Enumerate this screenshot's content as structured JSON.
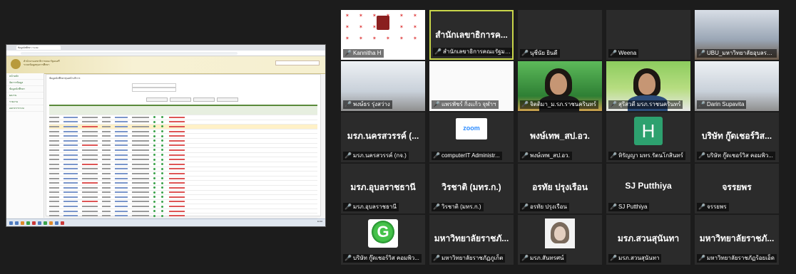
{
  "shared_screen": {
    "browser_tab": "ข้อมูลนักศึกษา / ระบบ",
    "banner_title": "สำนักงานเลขาธิการคณะรัฐมนตรี",
    "banner_subtitle": "ระบบข้อมูลทุนการศึกษา",
    "side_items": [
      "หน้าหลัก",
      "จัดการข้อมูล",
      "ข้อมูลนักศึกษา",
      "ผลงาน",
      "รายงาน",
      "ออกจากระบบ"
    ],
    "crumb": "ข้อมูลนักศึกษาทุนหน้าบริการ",
    "clock": "11:02"
  },
  "participants": [
    {
      "id": "p1",
      "video": "pattern",
      "name": "Kannitha H",
      "big": ""
    },
    {
      "id": "p2",
      "video": "none",
      "name": "สำนักเลขาธิการคณะรัฐมนตรี",
      "big": "สำนักเลขาธิการค...",
      "active": true
    },
    {
      "id": "p3",
      "video": "none",
      "name": "นุชี่นัย ยินดี",
      "big": ""
    },
    {
      "id": "p4",
      "video": "none",
      "name": "Weena",
      "big": ""
    },
    {
      "id": "p5",
      "video": "room",
      "name": "UBU_มหาวิทยาลัยอุบลรา...",
      "big": ""
    },
    {
      "id": "p6",
      "video": "office",
      "name": "พงษ์ธร รุ่งสว่าง",
      "big": ""
    },
    {
      "id": "p7",
      "video": "white",
      "name": "แพรพัชร์ กิ่งแก้ว จุฬาฯ",
      "big": ""
    },
    {
      "id": "p8",
      "video": "person-green",
      "name": "จิตติมา_ม.รภ.ราชนครินทร์",
      "big": ""
    },
    {
      "id": "p9",
      "video": "person-banner",
      "name": "สุรีสวดี มรภ.ราชนครินทร์",
      "big": ""
    },
    {
      "id": "p10",
      "video": "office2",
      "name": "Darin Supavita",
      "big": ""
    },
    {
      "id": "p11",
      "video": "none",
      "name": "มรภ.นครสวรรค์ (กจ.)",
      "big": "มรภ.นครสวรรค์ (..."
    },
    {
      "id": "p12",
      "video": "zoom",
      "name": "computerIT Administr...",
      "big": ""
    },
    {
      "id": "p13",
      "video": "none",
      "name": "พงษ์เทพ_สป.อว.",
      "big": "พงษ์เทพ_สป.อว."
    },
    {
      "id": "p14",
      "video": "h-avatar",
      "name": "หิรัญญา มทร.รัตนโกสินทร์",
      "big": ""
    },
    {
      "id": "p15",
      "video": "none",
      "name": "บริษัท กู๊ดเชอร์วิส คอมพิว...",
      "big": "บริษัท กู๊ดเชอร์วิส..."
    },
    {
      "id": "p16",
      "video": "none",
      "name": "มรภ.อุบลราชธานี",
      "big": "มรภ.อุบลราชธานี"
    },
    {
      "id": "p17",
      "video": "none",
      "name": "วิรชาติ (มทร.ก.)",
      "big": "วิรชาติ (มทร.ก.)"
    },
    {
      "id": "p18",
      "video": "none",
      "name": "อรทัย ปรุงเรือน",
      "big": "อรทัย ปรุงเรือน"
    },
    {
      "id": "p19",
      "video": "none",
      "name": "SJ Putthiya",
      "big": "SJ Putthiya"
    },
    {
      "id": "p20",
      "video": "none",
      "name": "จรรยพร",
      "big": "จรรยพร"
    },
    {
      "id": "p21",
      "video": "g-avatar",
      "name": "บริษัท กู๊ดเชอร์วิส คอมพิว...",
      "big": ""
    },
    {
      "id": "p22",
      "video": "none",
      "name": "มหาวิทยาลัยราชภัฏภูเก็ต",
      "big": "มหาวิทยาลัยราชภั..."
    },
    {
      "id": "p23",
      "video": "photo",
      "name": "มรภ.สันทรศน์",
      "big": ""
    },
    {
      "id": "p24",
      "video": "none",
      "name": "มรภ.สวนสุนันทา",
      "big": "มรภ.สวนสุนันทา"
    },
    {
      "id": "p25",
      "video": "none",
      "name": "มหาวิทยาลัยราชภัฏร้อยเอ็ด",
      "big": "มหาวิทยาลัยราชภั..."
    }
  ],
  "colors": {
    "active_border": "#c9d64a",
    "mic_muted": "#e63b3b"
  }
}
